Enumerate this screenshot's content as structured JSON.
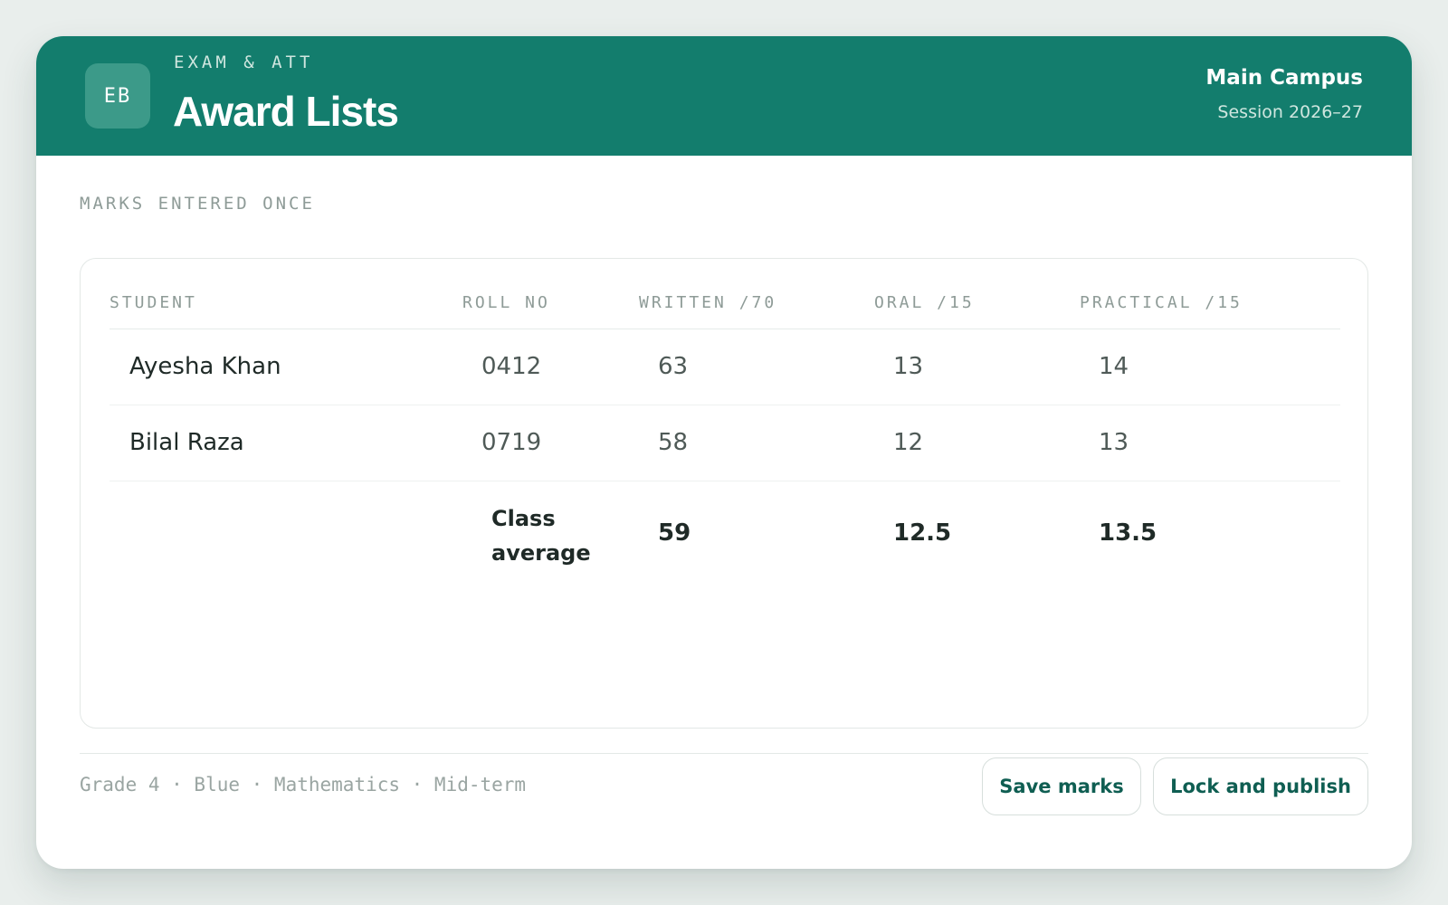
{
  "header": {
    "badge": "EB",
    "eyebrow": "EXAM & ATT",
    "title": "Award Lists",
    "campus": "Main Campus",
    "session": "Session 2026–27"
  },
  "section_label": "MARKS ENTERED ONCE",
  "table": {
    "columns": [
      "STUDENT",
      "ROLL NO",
      "WRITTEN /70",
      "ORAL /15",
      "PRACTICAL /15"
    ],
    "rows": [
      {
        "student": "Ayesha Khan",
        "roll": "0412",
        "written": "63",
        "oral": "13",
        "practical": "14"
      },
      {
        "student": "Bilal Raza",
        "roll": "0719",
        "written": "58",
        "oral": "12",
        "practical": "13"
      }
    ],
    "average": {
      "label": "Class average",
      "written": "59",
      "oral": "12.5",
      "practical": "13.5"
    }
  },
  "footer": {
    "meta": "Grade 4 · Blue · Mathematics · Mid-term",
    "save_label": "Save marks",
    "publish_label": "Lock and publish"
  },
  "colors": {
    "header_bg": "#137d6d",
    "badge_bg": "#3c9a89",
    "button_text": "#0f5e52"
  }
}
